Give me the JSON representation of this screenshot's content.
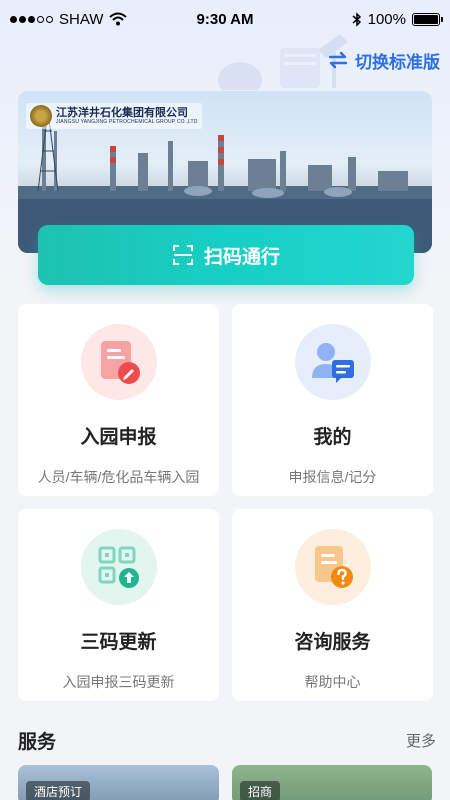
{
  "status_bar": {
    "carrier": "SHAW",
    "time": "9:30 AM",
    "battery": "100%"
  },
  "header": {
    "switch_label": "切换标准版"
  },
  "banner": {
    "company_cn": "江苏洋井石化集团有限公司",
    "company_en": "JIANGSU YANGJING PETROCHEMICAL GROUP CO.,LTD"
  },
  "scan": {
    "label": "扫码通行"
  },
  "cards": [
    {
      "title": "入园申报",
      "subtitle": "人员/车辆/危化品车辆入园",
      "icon": "document-edit-icon",
      "color": "#ef5a5a"
    },
    {
      "title": "我的",
      "subtitle": "申报信息/记分",
      "icon": "user-message-icon",
      "color": "#3b7cf0"
    },
    {
      "title": "三码更新",
      "subtitle": "入园申报三码更新",
      "icon": "qrcode-upload-icon",
      "color": "#1fb58f"
    },
    {
      "title": "咨询服务",
      "subtitle": "帮助中心",
      "icon": "help-document-icon",
      "color": "#f59a2b"
    }
  ],
  "services": {
    "title": "服务",
    "more": "更多",
    "items": [
      {
        "label": "酒店预订"
      },
      {
        "label": "招商"
      }
    ]
  }
}
